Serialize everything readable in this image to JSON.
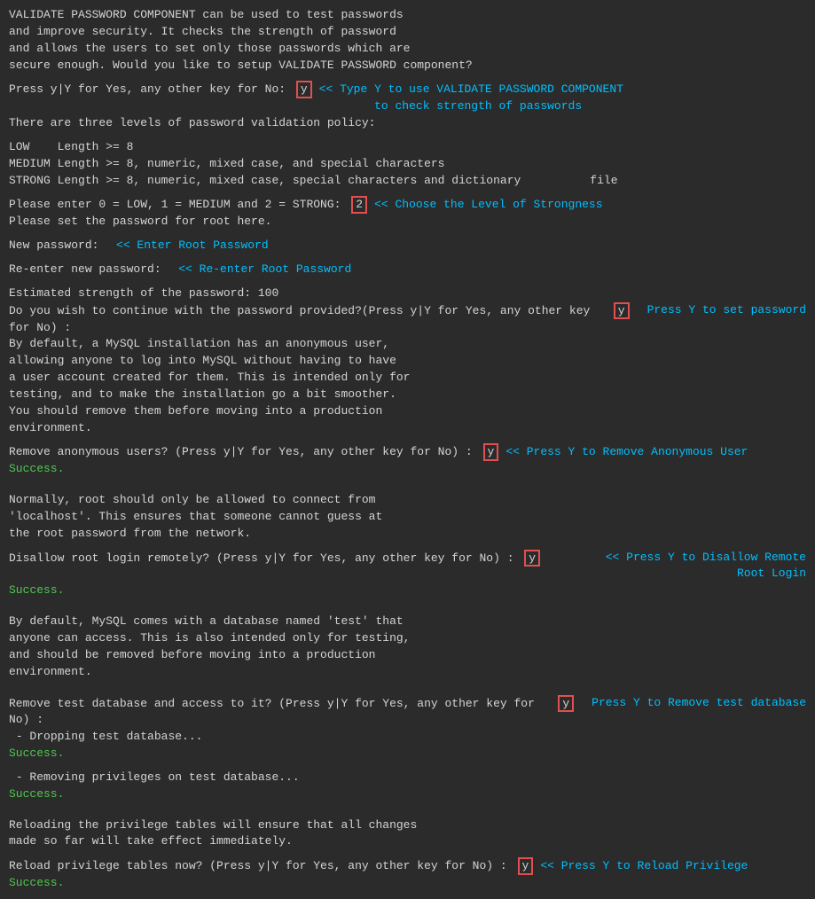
{
  "terminal": {
    "bg": "#2b2b2b",
    "text_color": "#d4d4d4",
    "annotation_color": "#00bfff",
    "highlight_color": "#e05050",
    "lines": [
      {
        "type": "text",
        "content": "VALIDATE PASSWORD COMPONENT can be used to test passwords"
      },
      {
        "type": "text",
        "content": "and improve security. It checks the strength of password"
      },
      {
        "type": "text",
        "content": "and allows the users to set only those passwords which are"
      },
      {
        "type": "text",
        "content": "secure enough. Would you like to setup VALIDATE PASSWORD component?"
      },
      {
        "type": "spacer"
      },
      {
        "type": "input_line",
        "before": "Press y|Y for Yes, any other key for No: ",
        "key": "y",
        "annotation": "<< Type Y to use VALIDATE PASSWORD COMPONENT\n        to check strength of passwords"
      },
      {
        "type": "text",
        "content": "There are three levels of password validation policy:"
      },
      {
        "type": "spacer"
      },
      {
        "type": "text",
        "content": "LOW    Length >= 8"
      },
      {
        "type": "text",
        "content": "MEDIUM Length >= 8, numeric, mixed case, and special characters"
      },
      {
        "type": "text",
        "content": "STRONG Length >= 8, numeric, mixed case, special characters and dictionary          file"
      },
      {
        "type": "spacer"
      },
      {
        "type": "input_line",
        "before": "Please enter 0 = LOW, 1 = MEDIUM and 2 = STRONG: ",
        "key": "2",
        "annotation": "<< Choose the Level of Strongness"
      },
      {
        "type": "text",
        "content": "Please set the password for root here."
      },
      {
        "type": "spacer"
      },
      {
        "type": "input_annotation_right",
        "before": "New password:  ",
        "annotation": "<< Enter Root Password"
      },
      {
        "type": "spacer"
      },
      {
        "type": "input_annotation_right",
        "before": "Re-enter new password:  ",
        "annotation": "<< Re-enter Root Password"
      },
      {
        "type": "spacer"
      },
      {
        "type": "text",
        "content": "Estimated strength of the password: 100"
      },
      {
        "type": "input_line_right_annotation",
        "before": "Do you wish to continue with the password provided?(Press y|Y for Yes, any other key for No) : ",
        "key": "y",
        "annotation": "Press Y to set password"
      },
      {
        "type": "text",
        "content": "By default, a MySQL installation has an anonymous user,"
      },
      {
        "type": "text",
        "content": "allowing anyone to log into MySQL without having to have"
      },
      {
        "type": "text",
        "content": "a user account created for them. This is intended only for"
      },
      {
        "type": "text",
        "content": "testing, and to make the installation go a bit smoother."
      },
      {
        "type": "text",
        "content": "You should remove them before moving into a production"
      },
      {
        "type": "text",
        "content": "environment."
      },
      {
        "type": "spacer"
      },
      {
        "type": "input_line",
        "before": "Remove anonymous users? (Press y|Y for Yes, any other key for No) : ",
        "key": "y",
        "annotation": "<< Press Y to Remove Anonymous User"
      },
      {
        "type": "green",
        "content": "Success."
      },
      {
        "type": "spacer"
      },
      {
        "type": "spacer"
      },
      {
        "type": "text",
        "content": "Normally, root should only be allowed to connect from"
      },
      {
        "type": "text",
        "content": "'localhost'. This ensures that someone cannot guess at"
      },
      {
        "type": "text",
        "content": "the root password from the network."
      },
      {
        "type": "spacer"
      },
      {
        "type": "input_line_right_annotation",
        "before": "Disallow root login remotely? (Press y|Y for Yes, any other key for No) : ",
        "key": "y",
        "annotation": "<< Press Y to Disallow Remote\n                        Root Login"
      },
      {
        "type": "green",
        "content": "Success."
      },
      {
        "type": "spacer"
      },
      {
        "type": "spacer"
      },
      {
        "type": "text",
        "content": "By default, MySQL comes with a database named 'test' that"
      },
      {
        "type": "text",
        "content": "anyone can access. This is also intended only for testing,"
      },
      {
        "type": "text",
        "content": "and should be removed before moving into a production"
      },
      {
        "type": "text",
        "content": "environment."
      },
      {
        "type": "spacer"
      },
      {
        "type": "spacer"
      },
      {
        "type": "input_line_right_annotation",
        "before": "Remove test database and access to it? (Press y|Y for Yes, any other key for No) : ",
        "key": "y",
        "annotation": "Press Y to Remove test database"
      },
      {
        "type": "text",
        "content": " - Dropping test database..."
      },
      {
        "type": "green",
        "content": "Success."
      },
      {
        "type": "spacer"
      },
      {
        "type": "text",
        "content": " - Removing privileges on test database..."
      },
      {
        "type": "green",
        "content": "Success."
      },
      {
        "type": "spacer"
      },
      {
        "type": "spacer"
      },
      {
        "type": "text",
        "content": "Reloading the privilege tables will ensure that all changes"
      },
      {
        "type": "text",
        "content": "made so far will take effect immediately."
      },
      {
        "type": "spacer"
      },
      {
        "type": "input_line",
        "before": "Reload privilege tables now? (Press y|Y for Yes, any other key for No) : ",
        "key": "y",
        "annotation": "<< Press Y to Reload Privilege"
      },
      {
        "type": "green",
        "content": "Success."
      }
    ]
  }
}
